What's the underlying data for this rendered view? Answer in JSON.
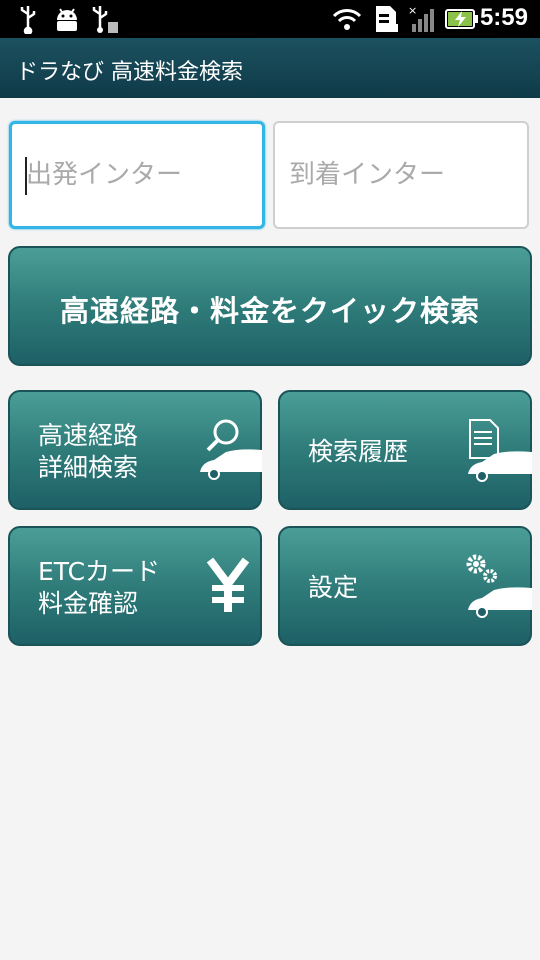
{
  "statusbar": {
    "time": "5:59"
  },
  "app": {
    "title": "ドラなび 高速料金検索"
  },
  "search": {
    "departure_placeholder": "出発インター",
    "arrival_placeholder": "到着インター"
  },
  "quick_search_label": "高速経路・料金をクイック検索",
  "menu": {
    "detail_line1": "高速経路",
    "detail_line2": "詳細検索",
    "history": "検索履歴",
    "etc_line1": "ETCカード",
    "etc_line2": "料金確認",
    "settings": "設定"
  },
  "colors": {
    "accent": "#33b5e5",
    "button_top": "#4b9e98",
    "button_bottom": "#1e6066",
    "titlebar": "#174858"
  }
}
